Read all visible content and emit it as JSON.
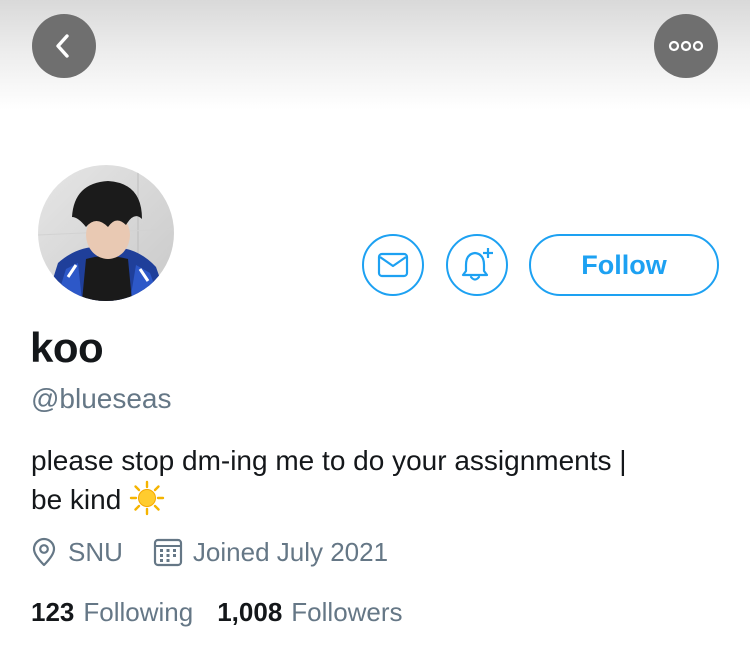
{
  "profile": {
    "display_name": "koo",
    "handle": "@blueseas",
    "bio_line1": "please stop dm-ing me to do your assignments |",
    "bio_line2": "be kind",
    "bio_emoji": "sun",
    "location": "SNU",
    "joined": "Joined July 2021",
    "following_count": "123",
    "following_label": "Following",
    "followers_count": "1,008",
    "followers_label": "Followers"
  },
  "actions": {
    "follow_label": "Follow"
  },
  "colors": {
    "accent": "#1da1f2",
    "secondary_text": "#657786",
    "primary_text": "#14171a",
    "nav_button_bg": "#6f6f6f"
  },
  "icons": {
    "back": "chevron-left-icon",
    "more": "more-horizontal-icon",
    "message": "envelope-icon",
    "notify": "bell-plus-icon",
    "location": "location-pin-icon",
    "joined": "calendar-icon"
  }
}
